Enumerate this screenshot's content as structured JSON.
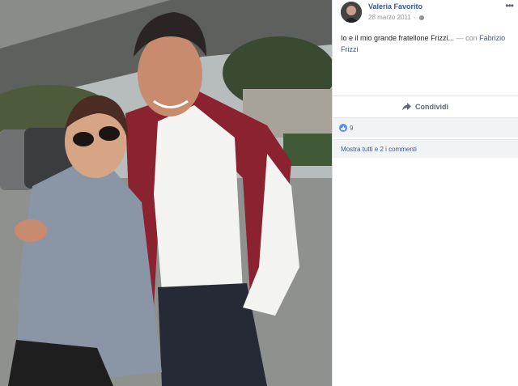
{
  "post": {
    "author": "Valeria Favorito",
    "date": "28 marzo 2011",
    "date_separator": "·",
    "privacy_icon": "globe-icon",
    "more_icon": "more-horizontal-icon",
    "caption_text": "Io e il mio grande fratellone Frizzi...",
    "with_prefix": " — con ",
    "tagged_name": "Fabrizio Frizzi"
  },
  "actions": {
    "share_label": "Condividi",
    "share_icon": "share-arrow-icon"
  },
  "reactions": {
    "like_icon": "like-icon",
    "count": "9",
    "color": "#4f8cff"
  },
  "comments": {
    "show_all_label": "Mostra tutti e 2 i commenti"
  },
  "colors": {
    "link": "#385898",
    "secondary_text": "#90949c",
    "panel_bg": "#f2f3f5"
  }
}
